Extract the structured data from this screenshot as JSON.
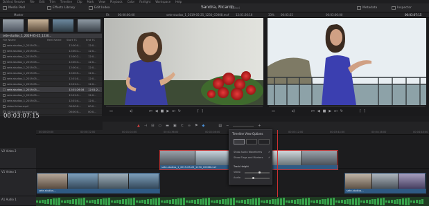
{
  "menubar": [
    "DaVinci Resolve",
    "File",
    "Edit",
    "Trim",
    "Timeline",
    "Clip",
    "Mark",
    "View",
    "Playback",
    "Color",
    "Fairlight",
    "Workspace",
    "Help"
  ],
  "topbar": {
    "media_pool": "Media Pool",
    "effects_library": "Effects Library",
    "edit_index": "Edit Index",
    "project_name": "Sandra, Ricardo",
    "project_status": "Edited",
    "metadata": "Metadata",
    "inspector": "Inspector"
  },
  "subbar": {
    "bin_name": "Master",
    "zoom_left": "Fit",
    "tc_left": "00:00:00:00",
    "clip_title": "sete-studios_1_2019-05-25_1230_C0008.mxf",
    "tc_mid": "12:01:26:16",
    "zoom_right": "33%",
    "tc_right_a": "00:03:25",
    "tc_right_b": "00:03:00:00",
    "tc_right_c": "00:03:07:15"
  },
  "media_pool": {
    "selected_thumb": "sete-studios_1_2019-05-25_1230...",
    "columns": [
      "File Name",
      "Reel Name",
      "Start TC",
      "End TC"
    ],
    "rows": [
      {
        "name": "sete-studios_1_2019-05-...",
        "tk": "",
        "st": "12:00:0...",
        "sp": "12:0..."
      },
      {
        "name": "sete-studios_1_2019-05-...",
        "tk": "",
        "st": "12:00:1...",
        "sp": "12:0..."
      },
      {
        "name": "sete-studios_1_2019-05-...",
        "tk": "",
        "st": "12:00:2...",
        "sp": "12:0..."
      },
      {
        "name": "sete-studios_1_2019-05-...",
        "tk": "",
        "st": "12:00:3...",
        "sp": "12:0..."
      },
      {
        "name": "sete-studios_1_2019-05-...",
        "tk": "",
        "st": "12:00:4...",
        "sp": "12:0..."
      },
      {
        "name": "sete-studios_1_2019-05-...",
        "tk": "",
        "st": "12:00:5...",
        "sp": "12:0..."
      },
      {
        "name": "sete-studios_1_2019-05-...",
        "tk": "",
        "st": "12:01:0...",
        "sp": "12:0..."
      },
      {
        "name": "sete-studios_1_2019-05-...",
        "tk": "",
        "st": "12:01:1...",
        "sp": "12:0..."
      },
      {
        "name": "sete-studios_1_2019-05-...",
        "tk": "",
        "st": "12:01:26:16",
        "sp": "12:01:2..."
      },
      {
        "name": "sete-studios_1_2019-05-...",
        "tk": "",
        "st": "12:01:3...",
        "sp": "12:0..."
      },
      {
        "name": "sete-studios_1_2019-05-...",
        "tk": "",
        "st": "12:01:4...",
        "sp": "12:0..."
      },
      {
        "name": "video-linhas.mp4",
        "tk": "",
        "st": "00:00:0...",
        "sp": "00:0..."
      },
      {
        "name": "1920x1080-timeline.jpg",
        "tk": "",
        "st": "00:00:0...",
        "sp": "00:0..."
      },
      {
        "name": "entrevista",
        "tk": "",
        "st": "00:00:0...",
        "sp": "00:0..."
      }
    ],
    "selected_row": 8
  },
  "timeline": {
    "timecode": "00:03:07:15",
    "ruler_ticks": [
      "00:00:00:00",
      "00:00:32:00",
      "00:01:04:00",
      "00:01:36:00",
      "00:02:08:00",
      "00:02:40:00",
      "00:03:12:00",
      "00:03:44:00",
      "00:04:16:00",
      "00:04:48:00"
    ],
    "tracks": [
      {
        "id": "V2",
        "label": "Video 2"
      },
      {
        "id": "V1",
        "label": "Video 1"
      },
      {
        "id": "A1",
        "label": "Audio 1"
      }
    ],
    "clip_v2": "sete-studios_1_2019-05-25_1230_C0008.mxf",
    "clip_v1_a": "sete-studios...",
    "clip_v1_b": "sete-studios..."
  },
  "popover": {
    "title": "Timeline View Options",
    "check_waveforms": "Show Audio Waveforms",
    "check_flags": "Show Flags and Markers",
    "track_height": "Track Height",
    "video_label": "Video",
    "audio_label": "Audio",
    "video_height": 0.6,
    "audio_height": 0.35
  },
  "colors": {
    "accent": "#c0392b",
    "clip_blue": "#2f5a84",
    "audio_green": "#36a24a"
  }
}
